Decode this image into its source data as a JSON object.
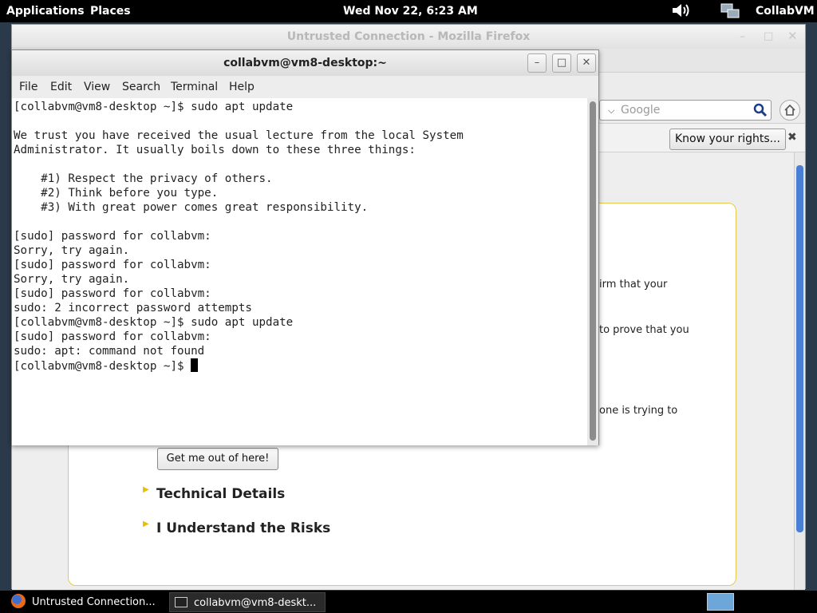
{
  "topbar": {
    "applications": "Applications",
    "places": "Places",
    "clock": "Wed Nov 22,  6:23 AM",
    "user": "CollabVM",
    "volume_icon": "volume-icon",
    "network_icon": "network-icon"
  },
  "firefox": {
    "title": "Untrusted Connection - Mozilla Firefox",
    "search_placeholder": "Google",
    "know_rights": "Know your rights...",
    "visible_fragments": [
      "irm that your",
      "to prove that you",
      "one is trying to"
    ],
    "get_me_out": "Get me out of here!",
    "technical_details": "Technical Details",
    "understand_risks": "I Understand the Risks"
  },
  "terminal": {
    "title": "collabvm@vm8-desktop:~",
    "menu": [
      "File",
      "Edit",
      "View",
      "Search",
      "Terminal",
      "Help"
    ],
    "lines": [
      "[collabvm@vm8-desktop ~]$ sudo apt update",
      "",
      "We trust you have received the usual lecture from the local System",
      "Administrator. It usually boils down to these three things:",
      "",
      "    #1) Respect the privacy of others.",
      "    #2) Think before you type.",
      "    #3) With great power comes great responsibility.",
      "",
      "[sudo] password for collabvm:",
      "Sorry, try again.",
      "[sudo] password for collabvm:",
      "Sorry, try again.",
      "[sudo] password for collabvm:",
      "sudo: 2 incorrect password attempts",
      "[collabvm@vm8-desktop ~]$ sudo apt update",
      "[sudo] password for collabvm:",
      "sudo: apt: command not found",
      "[collabvm@vm8-desktop ~]$ "
    ]
  },
  "taskbar": {
    "items": [
      "Untrusted Connection...",
      "collabvm@vm8-deskt..."
    ]
  },
  "colors": {
    "ff_warning_border": "#e8c84a",
    "terminal_bg": "#ffffff"
  }
}
